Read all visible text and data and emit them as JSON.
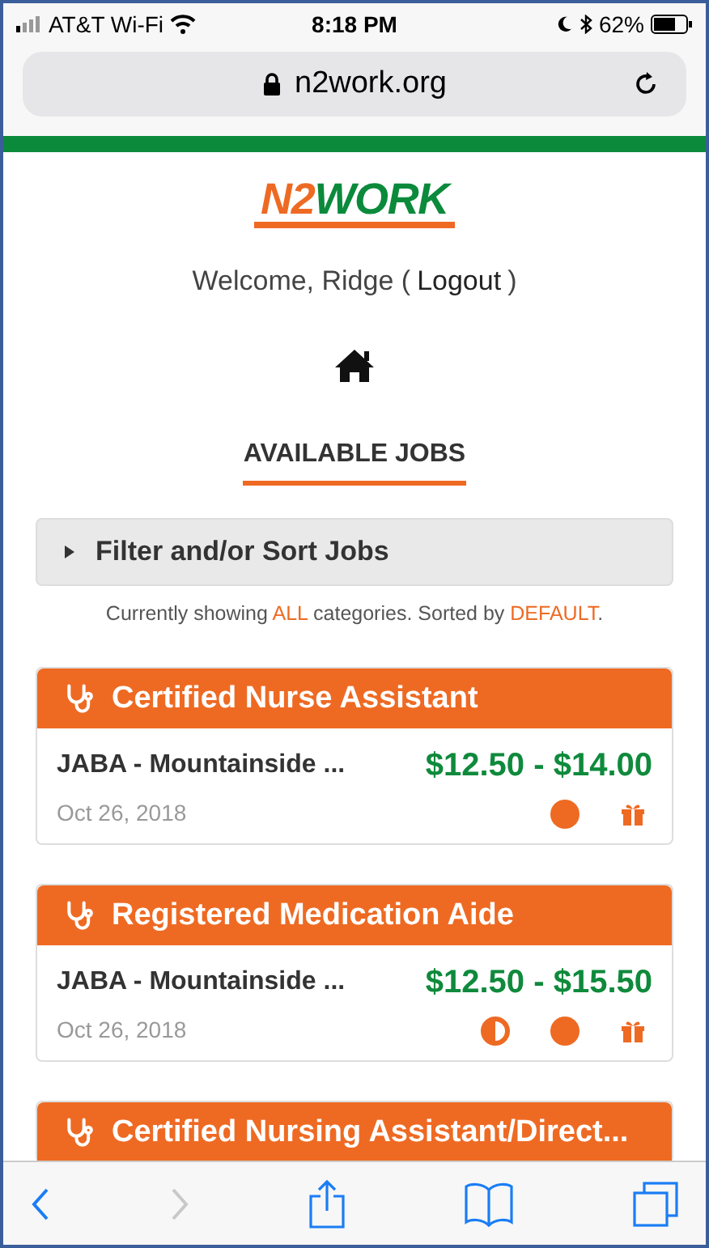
{
  "status_bar": {
    "carrier": "AT&T Wi-Fi",
    "time": "8:18 PM",
    "battery": "62%"
  },
  "address_bar": {
    "url": "n2work.org"
  },
  "logo": {
    "left": "N2",
    "right": "WORK"
  },
  "welcome": {
    "text": "Welcome, Ridge (",
    "link": "Logout",
    "close": ")"
  },
  "section_title": "AVAILABLE JOBS",
  "filter": {
    "label": "Filter and/or Sort Jobs",
    "expanded": false
  },
  "summary": {
    "prefix": "Currently showing",
    "category": "ALL",
    "middle": "categories. Sorted by",
    "sort": "DEFAULT",
    "suffix": "."
  },
  "jobs": [
    {
      "title": "Certified Nurse Assistant",
      "employer": "JABA - Mountainside ...",
      "pay": "$12.50 - $14.00",
      "date": "Oct 26, 2018",
      "badges": [
        {
          "kind": "full"
        },
        {
          "kind": "gift"
        }
      ]
    },
    {
      "title": "Registered Medication Aide",
      "employer": "JABA - Mountainside ...",
      "pay": "$12.50 - $15.50",
      "date": "Oct 26, 2018",
      "badges": [
        {
          "kind": "half"
        },
        {
          "kind": "full"
        },
        {
          "kind": "gift"
        }
      ]
    },
    {
      "title": "Certified Nursing Assistant/Direct..."
    }
  ],
  "toolbar": {
    "back_disabled": false,
    "forward_disabled": true
  }
}
